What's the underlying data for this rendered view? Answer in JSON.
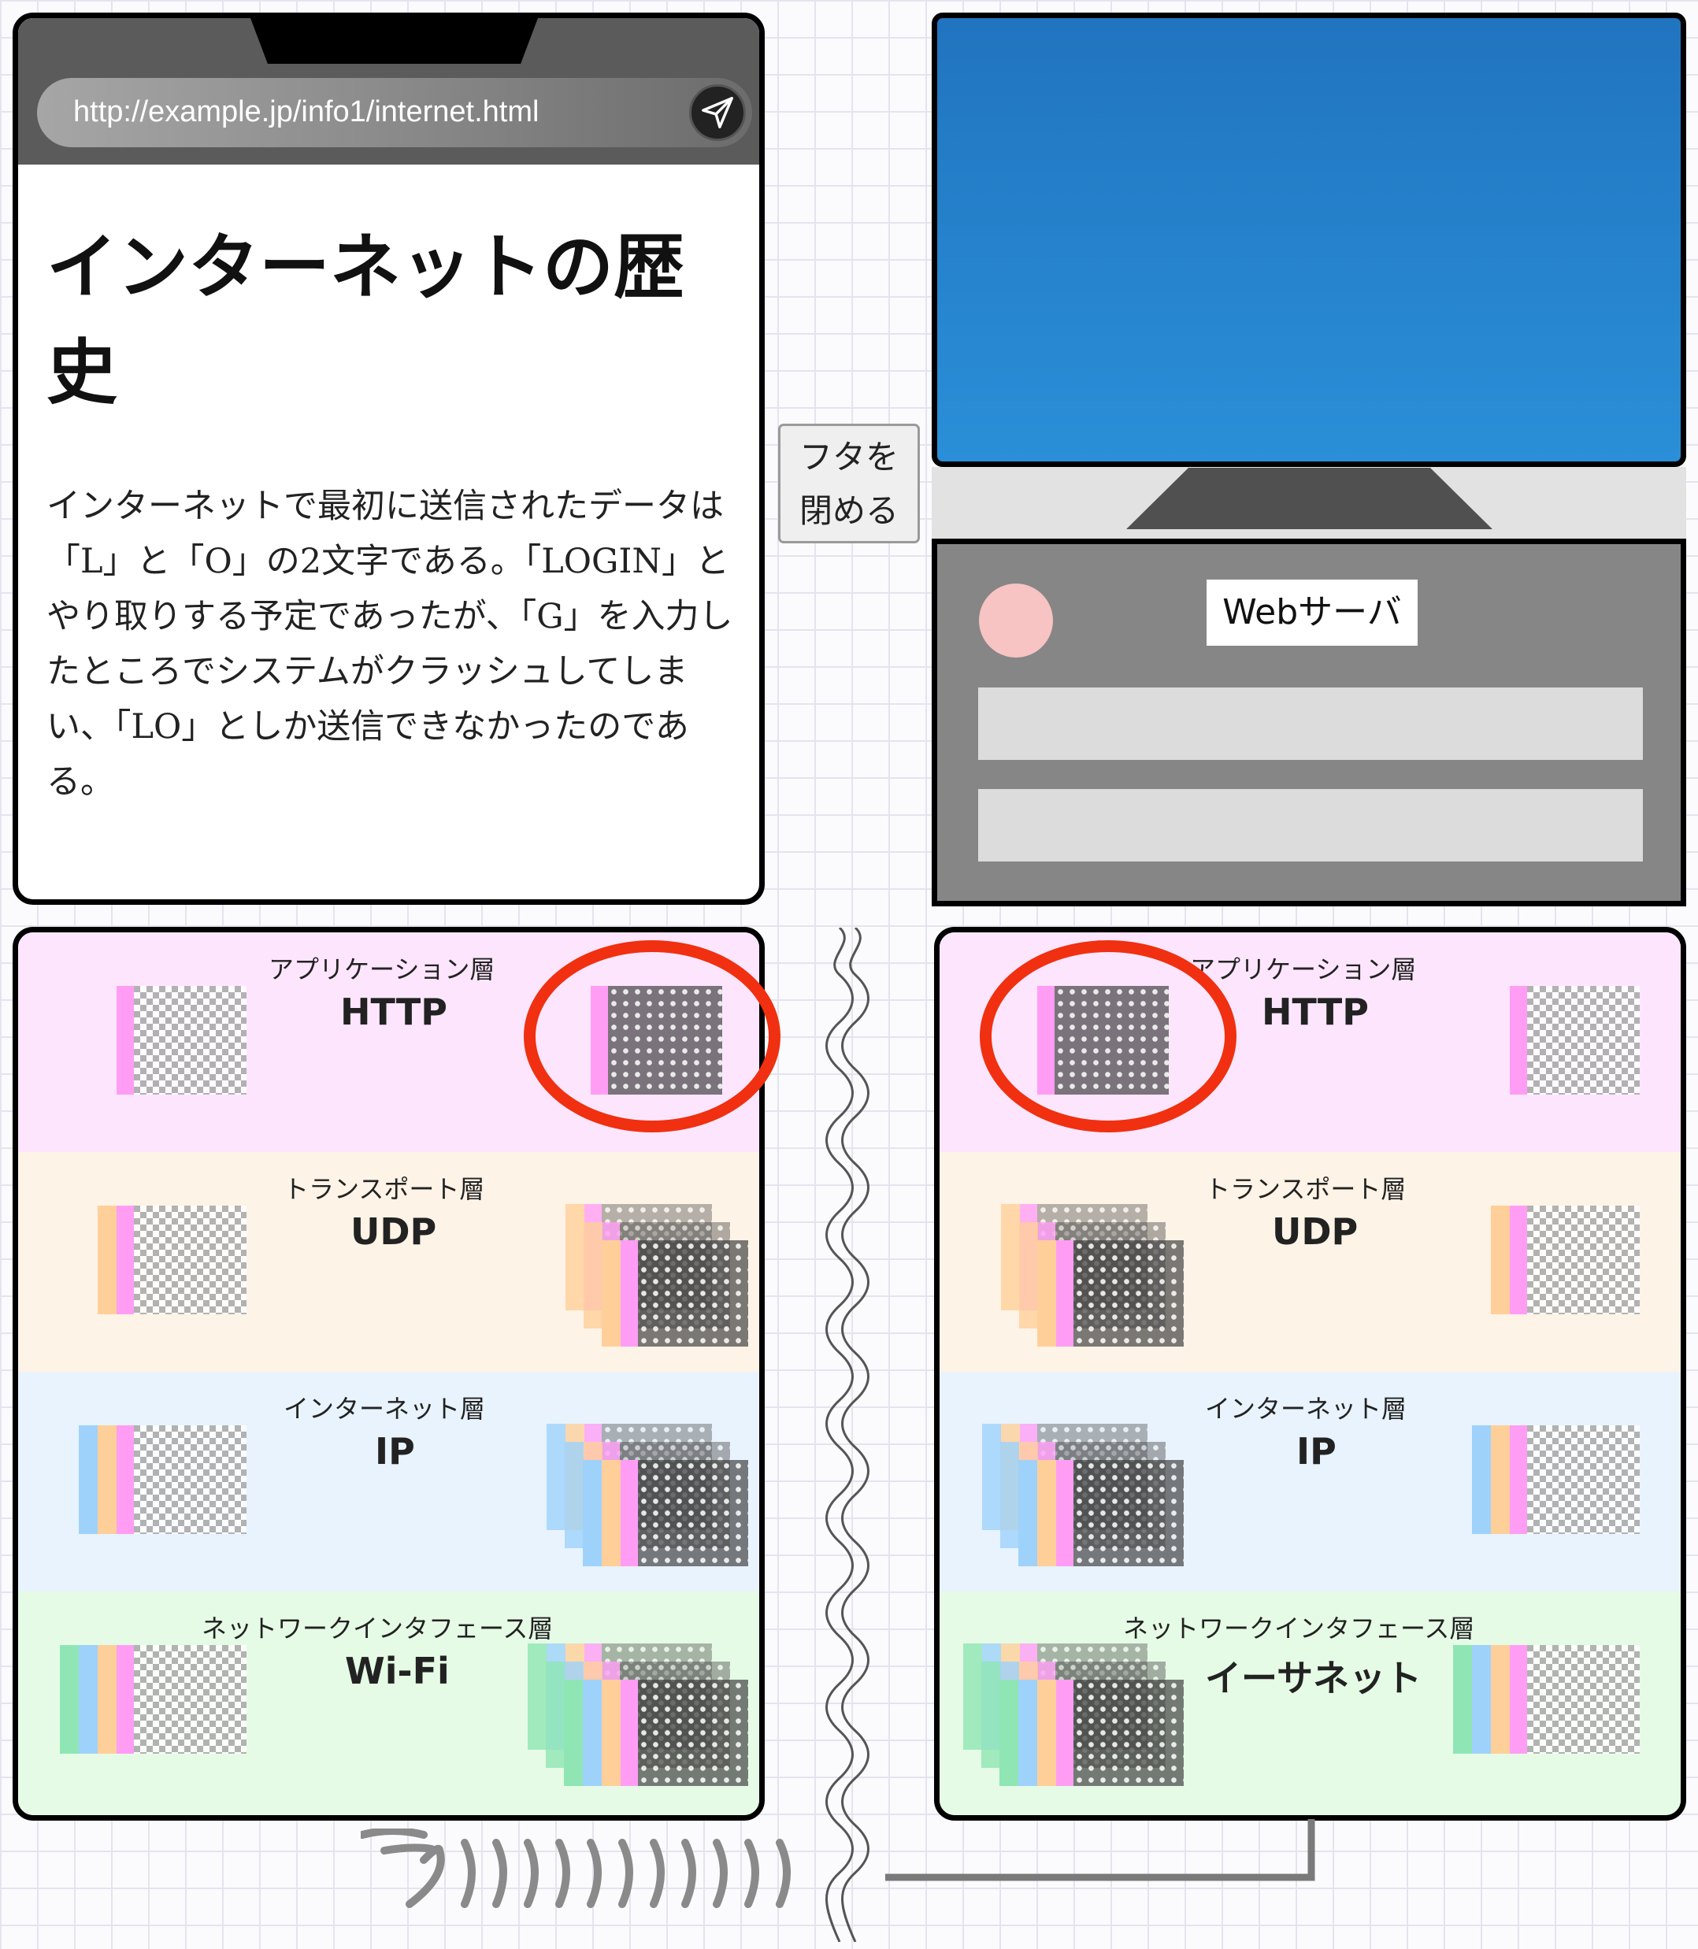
{
  "browser": {
    "url": "http://example.jp/info1/internet.html",
    "send_icon": "send-icon",
    "page_title": "インターネットの歴史",
    "page_body": "インターネットで最初に送信されたデータは「L」と「O」の2文字である。「LOGIN」とやり取りする予定であったが、「G」を入力したところでシステムがクラッシュしてしまい、「LO」としか送信できなかったのである。"
  },
  "lid_button": {
    "line1": "フタを",
    "line2": "閉める"
  },
  "server": {
    "label": "Webサーバ"
  },
  "client_stack": {
    "layers": [
      {
        "name": "アプリケーション層",
        "protocol": "HTTP"
      },
      {
        "name": "トランスポート層",
        "protocol": "UDP"
      },
      {
        "name": "インターネット層",
        "protocol": "IP"
      },
      {
        "name": "ネットワークインタフェース層",
        "protocol": "Wi-Fi"
      }
    ]
  },
  "server_stack": {
    "layers": [
      {
        "name": "アプリケーション層",
        "protocol": "HTTP"
      },
      {
        "name": "トランスポート層",
        "protocol": "UDP"
      },
      {
        "name": "インターネット層",
        "protocol": "IP"
      },
      {
        "name": "ネットワークインタフェース層",
        "protocol": "イーサネット"
      }
    ]
  },
  "colors": {
    "accent_highlight": "#f03010",
    "header_app": "#ff9df5",
    "header_transport": "#ffcf9a",
    "header_internet": "#9ed2fb",
    "header_network": "#8fe6b4",
    "monitor_screen": "#2580cc",
    "server_led": "#f8c3c3"
  }
}
